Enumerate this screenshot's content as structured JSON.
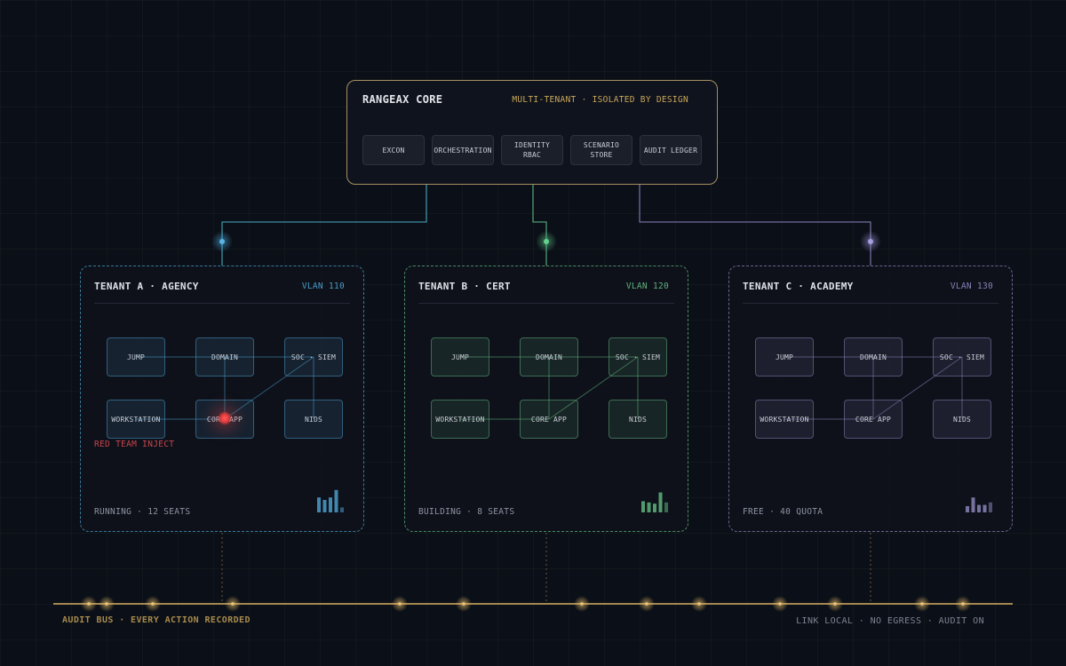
{
  "core": {
    "title": "RANGEAX CORE",
    "subtitle": "MULTI-TENANT · ISOLATED BY DESIGN",
    "services": [
      {
        "label": "EXCON"
      },
      {
        "label": "ORCHESTRATION"
      },
      {
        "label_line1": "IDENTITY",
        "label_line2": "RBAC"
      },
      {
        "label": "SCENARIO STORE"
      },
      {
        "label": "AUDIT LEDGER"
      }
    ]
  },
  "tenants": [
    {
      "title": "TENANT A · AGENCY",
      "vlan": "VLAN 110",
      "status": "RUNNING · 12 SEATS",
      "accent": "#4a9cc9",
      "nodes": [
        "JUMP",
        "DOMAIN",
        "SOC · SIEM",
        "WORKSTATION",
        "CORE APP",
        "NIDS"
      ],
      "annotation": "RED TEAM INJECT",
      "activity": [
        0.6,
        0.5,
        0.6,
        0.9,
        0.2
      ]
    },
    {
      "title": "TENANT B · CERT",
      "vlan": "VLAN 120",
      "status": "BUILDING · 8 SEATS",
      "accent": "#5fb37e",
      "nodes": [
        "JUMP",
        "DOMAIN",
        "SOC · SIEM",
        "WORKSTATION",
        "CORE APP",
        "NIDS"
      ],
      "activity": [
        0.45,
        0.4,
        0.35,
        0.8,
        0.4
      ]
    },
    {
      "title": "TENANT C · ACADEMY",
      "vlan": "VLAN 130",
      "status": "FREE · 40 QUOTA",
      "accent": "#8a82b8",
      "nodes": [
        "JUMP",
        "DOMAIN",
        "SOC · SIEM",
        "WORKSTATION",
        "CORE APP",
        "NIDS"
      ],
      "activity": [
        0.25,
        0.6,
        0.3,
        0.3,
        0.4
      ]
    }
  ],
  "bus": {
    "label": "AUDIT BUS · EVERY ACTION RECORDED",
    "note": "LINK LOCAL · NO EGRESS · AUDIT ON",
    "color": "#b8985a"
  }
}
